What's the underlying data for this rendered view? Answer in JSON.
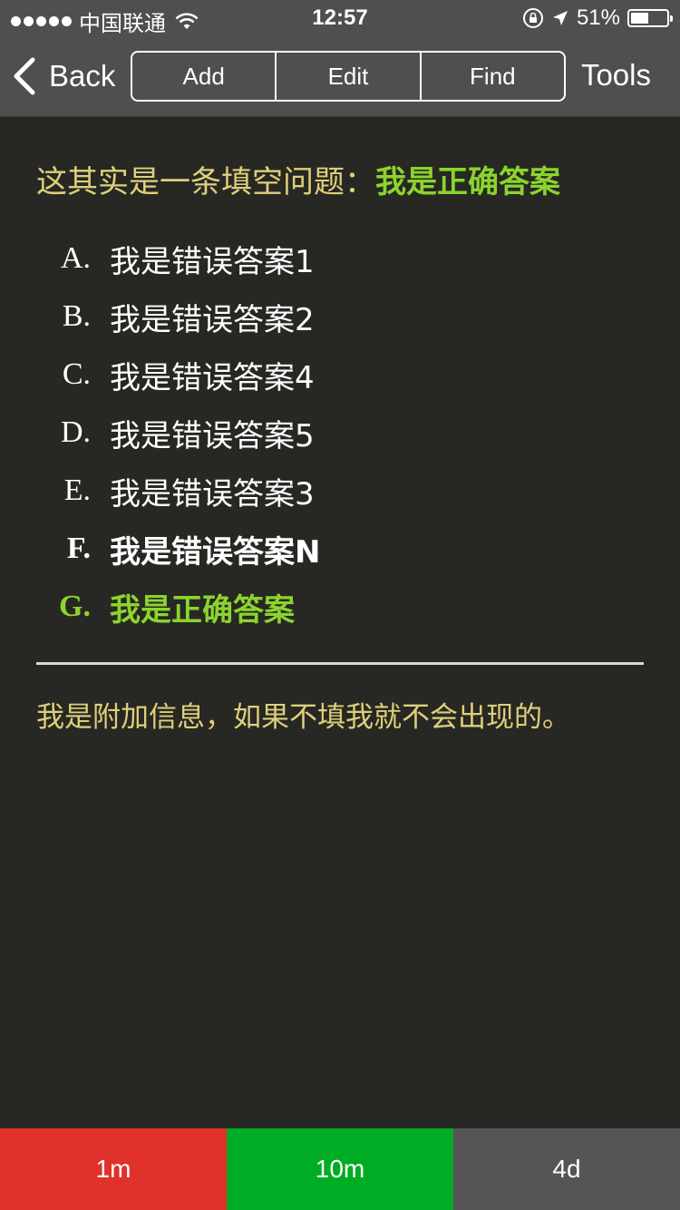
{
  "status_bar": {
    "carrier": "中国联通",
    "time": "12:57",
    "battery_text": "51%",
    "battery_level": 0.51,
    "signal_bars": 5
  },
  "nav": {
    "back_label": "Back",
    "segments": [
      "Add",
      "Edit",
      "Find"
    ],
    "tools_label": "Tools"
  },
  "question": {
    "prompt": "这其实是一条填空问题：",
    "answer": "我是正确答案"
  },
  "options": [
    {
      "letter": "A.",
      "text": "我是错误答案1"
    },
    {
      "letter": "B.",
      "text": "我是错误答案2"
    },
    {
      "letter": "C.",
      "text": "我是错误答案4"
    },
    {
      "letter": "D.",
      "text": "我是错误答案5"
    },
    {
      "letter": "E.",
      "text": "我是错误答案3"
    },
    {
      "letter": "F.",
      "text": "我是错误答案N"
    },
    {
      "letter": "G.",
      "text": "我是正确答案"
    }
  ],
  "extra_info": "我是附加信息，如果不填我就不会出现的。",
  "bottom_buttons": [
    {
      "label": "1m",
      "color": "#e0312b"
    },
    {
      "label": "10m",
      "color": "#00ac24"
    },
    {
      "label": "4d",
      "color": "#555555"
    }
  ],
  "colors": {
    "background": "#272823",
    "bar": "#4f4f4f",
    "question_text": "#dfcf7b",
    "correct": "#8cd42d"
  }
}
